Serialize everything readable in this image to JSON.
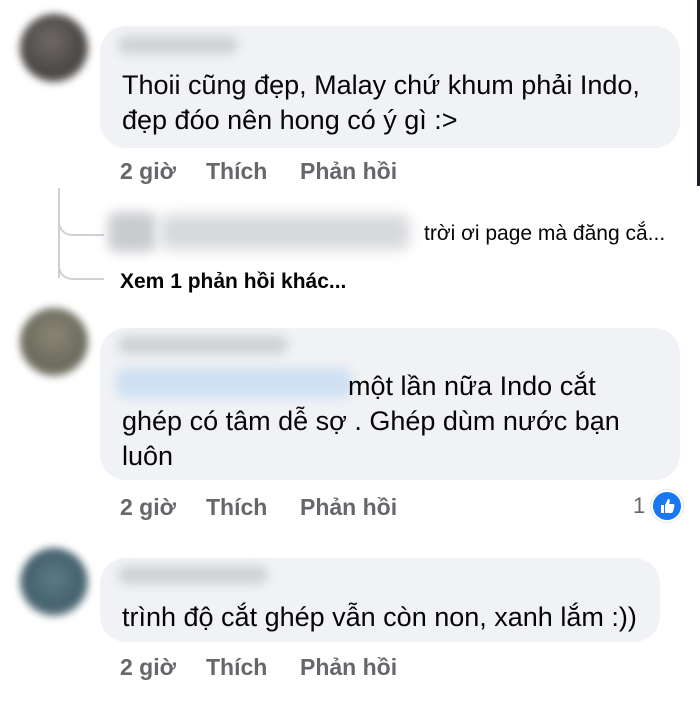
{
  "comments": [
    {
      "text_line1": "Thoii cũng đẹp, Malay chứ khum phải Indo,",
      "text_line2": "đẹp đóo nên hong có ý gì :>",
      "time": "2 giờ",
      "like": "Thích",
      "reply": "Phản hồi"
    },
    {
      "text_line1": "một lần nữa Indo cắt",
      "text_line2": "ghép có tâm dễ sợ . Ghép dùm nước bạn",
      "text_line3": "luôn",
      "time": "2 giờ",
      "like": "Thích",
      "reply": "Phản hồi",
      "reaction_count": "1",
      "reaction": "like-icon"
    },
    {
      "text_line1": "trình độ cắt ghép vẫn còn non, xanh lắm :))",
      "time": "2 giờ",
      "like": "Thích",
      "reply": "Phản hồi"
    }
  ],
  "reply_preview": {
    "text": "trời ơi page mà đăng cắ..."
  },
  "more_replies": "Xem 1 phản hồi khác...",
  "colors": {
    "bubble": "#f0f2f5",
    "meta": "#65676b",
    "text": "#050505",
    "like_blue": "#1877f2"
  }
}
